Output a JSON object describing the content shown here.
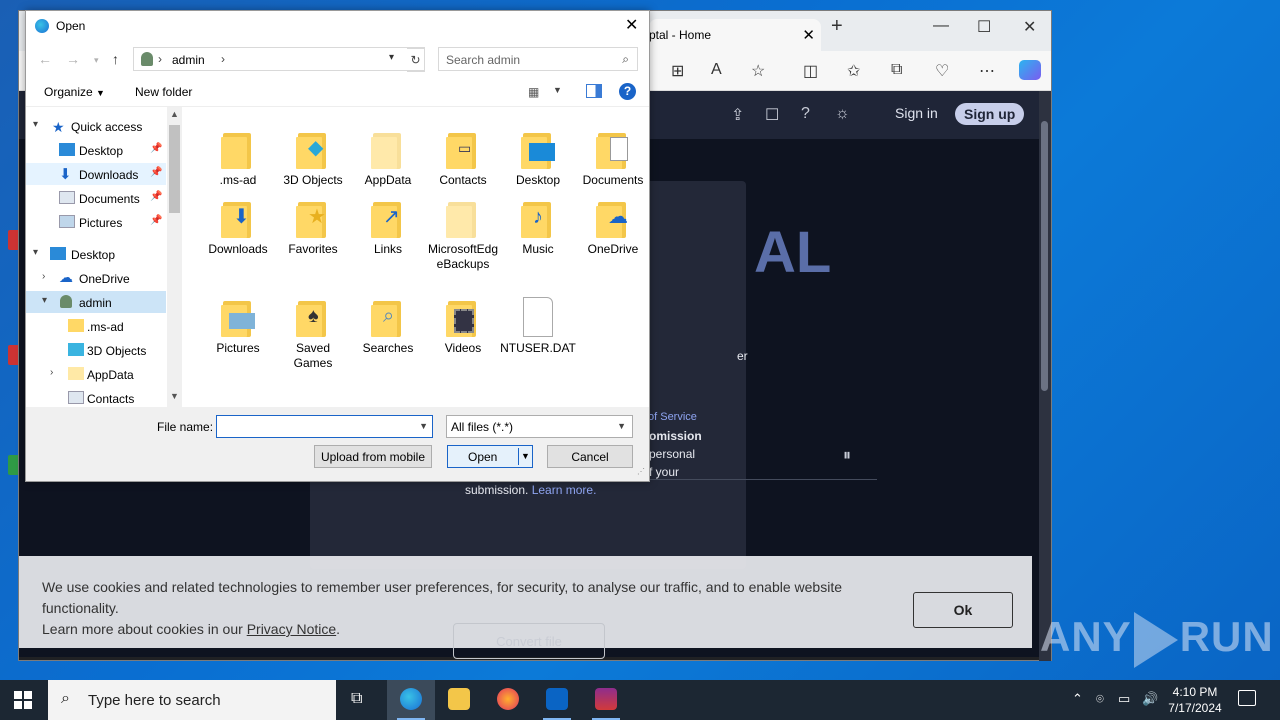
{
  "dialog": {
    "title": "Open",
    "address": {
      "segment": "admin"
    },
    "search_placeholder": "Search admin",
    "organize": "Organize",
    "new_folder": "New folder",
    "nav": [
      {
        "label": "Quick access"
      },
      {
        "label": "Desktop"
      },
      {
        "label": "Downloads"
      },
      {
        "label": "Documents"
      },
      {
        "label": "Pictures"
      },
      {
        "label": "Desktop"
      },
      {
        "label": "OneDrive"
      },
      {
        "label": "admin"
      },
      {
        "label": ".ms-ad"
      },
      {
        "label": "3D Objects"
      },
      {
        "label": "AppData"
      },
      {
        "label": "Contacts"
      }
    ],
    "files": [
      {
        "name": ".ms-ad"
      },
      {
        "name": "3D Objects"
      },
      {
        "name": "AppData"
      },
      {
        "name": "Contacts"
      },
      {
        "name": "Desktop"
      },
      {
        "name": "Documents"
      },
      {
        "name": "Downloads"
      },
      {
        "name": "Favorites"
      },
      {
        "name": "Links"
      },
      {
        "name": "MicrosoftEdgeBackups"
      },
      {
        "name": "Music"
      },
      {
        "name": "OneDrive"
      },
      {
        "name": "Pictures"
      },
      {
        "name": "Saved Games"
      },
      {
        "name": "Searches"
      },
      {
        "name": "Videos"
      },
      {
        "name": "NTUSER.DAT"
      }
    ],
    "file_name_label": "File name:",
    "file_name_value": "",
    "filter": "All files (*.*)",
    "upload_button": "Upload from mobile",
    "open_button": "Open",
    "cancel_button": "Cancel"
  },
  "browser": {
    "tab_title": "ptal - Home",
    "sign_in": "Sign in",
    "sign_up": "Sign up",
    "modal": {
      "big_text": "AL",
      "frag1": "er",
      "tos": "of Service",
      "frag_submission": "omission",
      "frag_personal": "personal",
      "frag_your": "f your",
      "frag_submission2": "submission.",
      "learn_more": "Learn more."
    },
    "cookie": {
      "line1": "We use cookies and related technologies to remember user preferences, for security, to analyse our traffic, and to enable website functionality.",
      "line2_prefix": "Learn more about cookies in our ",
      "privacy_link": "Privacy Notice",
      "line2_suffix": ".",
      "ok": "Ok"
    },
    "faint_button": "Convert file"
  },
  "taskbar": {
    "search_placeholder": "Type here to search",
    "time": "4:10 PM",
    "date": "7/17/2024"
  },
  "watermark": {
    "left": "ANY",
    "right": "RUN"
  }
}
